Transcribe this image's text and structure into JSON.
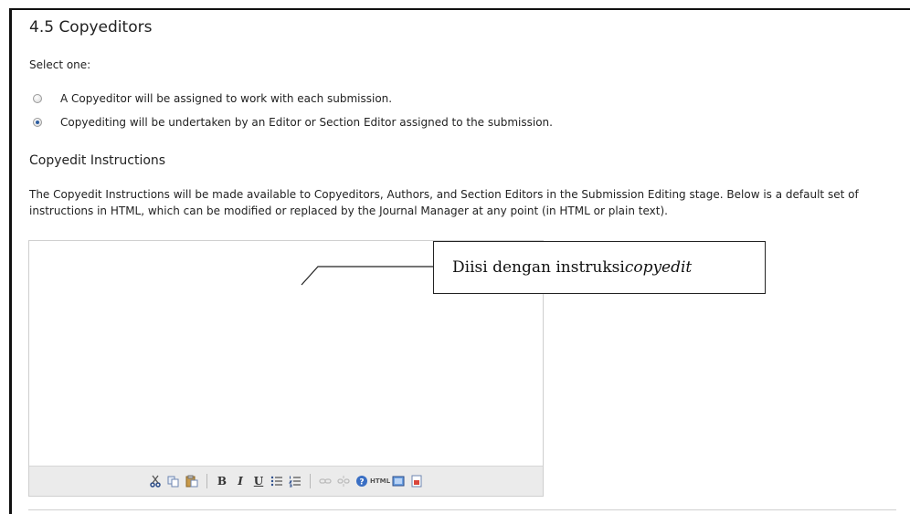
{
  "section": {
    "title": "4.5 Copyeditors",
    "select_label": "Select one:"
  },
  "options": [
    {
      "label": "A Copyeditor will be assigned to work with each submission.",
      "checked": false
    },
    {
      "label": "Copyediting will be undertaken by an Editor or Section Editor assigned to the submission.",
      "checked": true
    }
  ],
  "copyedit": {
    "heading": "Copyedit Instructions",
    "description": "The Copyedit Instructions will be made available to Copyeditors, Authors, and Section Editors in the Submission Editing stage. Below is a default set of instructions in HTML, which can be modified or replaced by the Journal Manager at any point (in HTML or plain text).",
    "editor_value": ""
  },
  "toolbar": {
    "bold_label": "B",
    "italic_label": "I",
    "underline_label": "U",
    "html_label": "HTML",
    "buttons": [
      "cut-icon",
      "copy-icon",
      "paste-icon",
      "bold",
      "italic",
      "underline",
      "bullet-list-icon",
      "numbered-list-icon",
      "link-icon",
      "unlink-icon",
      "help-icon",
      "html-icon",
      "fullscreen-icon",
      "insert-image-icon"
    ]
  },
  "callout": {
    "text_prefix": "Diisi dengan instruksi ",
    "text_italic": "copyedit"
  },
  "colors": {
    "radio_checked": "#2d5da0",
    "toolbar_bg": "#ebebeb"
  }
}
